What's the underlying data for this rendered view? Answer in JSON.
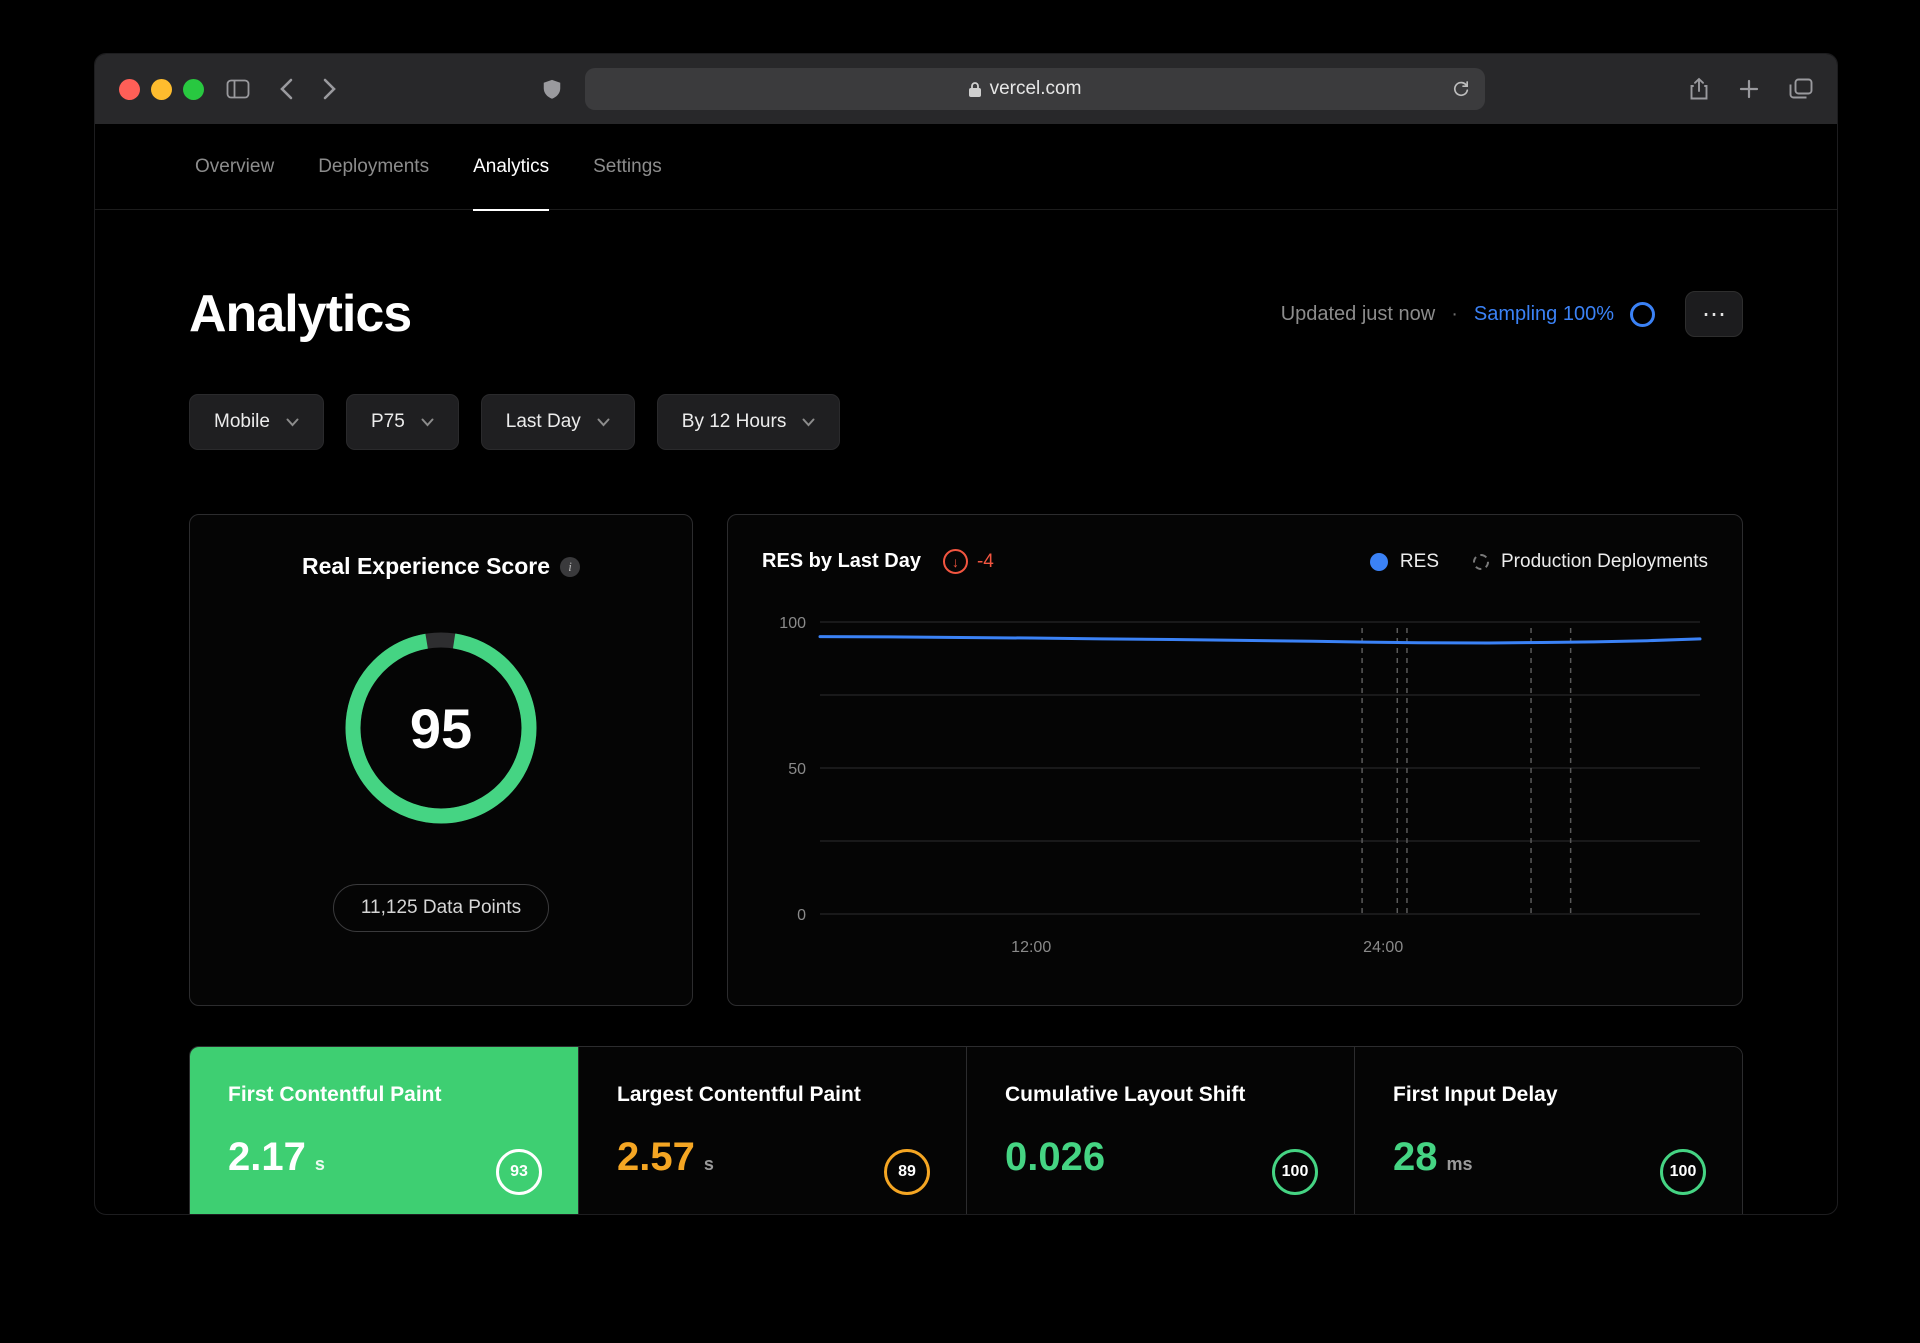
{
  "browser": {
    "url": "vercel.com",
    "traffic_lights": [
      "#ff5f57",
      "#febc2e",
      "#28c840"
    ]
  },
  "nav": {
    "tabs": [
      {
        "label": "Overview",
        "active": false
      },
      {
        "label": "Deployments",
        "active": false
      },
      {
        "label": "Analytics",
        "active": true
      },
      {
        "label": "Settings",
        "active": false
      }
    ]
  },
  "header": {
    "title": "Analytics",
    "updated": "Updated just now",
    "separator": "·",
    "sampling": "Sampling 100%",
    "accent_blue": "#3b82f6"
  },
  "icons": {
    "info": "i",
    "arrow_down": "↓",
    "ellipsis": "⋯"
  },
  "filters": [
    {
      "label": "Mobile"
    },
    {
      "label": "P75"
    },
    {
      "label": "Last Day"
    },
    {
      "label": "By 12 Hours"
    }
  ],
  "res_card": {
    "title": "Real Experience Score",
    "score": 95,
    "data_points": "11,125 Data Points",
    "ring_color": "#45d483"
  },
  "chart_card": {
    "title": "RES by Last Day",
    "delta": "-4",
    "delta_color": "#f25540",
    "legend": [
      {
        "label": "RES",
        "color": "#3b82f6"
      },
      {
        "label": "Production Deployments"
      }
    ]
  },
  "chart_data": {
    "type": "line",
    "title": "RES by Last Day",
    "ylim": [
      0,
      100
    ],
    "y_gridlines": [
      0,
      25,
      50,
      75,
      100
    ],
    "y_tick_labels": [
      100,
      50,
      0
    ],
    "x_ticks": [
      {
        "label": "12:00",
        "pos": 0.24
      },
      {
        "label": "24:00",
        "pos": 0.64
      }
    ],
    "series": [
      {
        "name": "RES",
        "color": "#3b82f6",
        "points": [
          [
            0,
            95
          ],
          [
            0.08,
            94.9
          ],
          [
            0.16,
            94.7
          ],
          [
            0.24,
            94.5
          ],
          [
            0.32,
            94.2
          ],
          [
            0.4,
            94.0
          ],
          [
            0.48,
            93.7
          ],
          [
            0.56,
            93.4
          ],
          [
            0.62,
            93.1
          ],
          [
            0.68,
            92.9
          ],
          [
            0.76,
            92.8
          ],
          [
            0.82,
            93.0
          ],
          [
            0.88,
            93.2
          ],
          [
            0.94,
            93.6
          ],
          [
            1,
            94.2
          ]
        ]
      }
    ],
    "deployments": {
      "name": "Production Deployments",
      "color": "#5a5a5a",
      "positions": [
        0.616,
        0.656,
        0.667,
        0.808,
        0.853
      ]
    }
  },
  "metrics": [
    {
      "title": "First Contentful Paint",
      "value": "2.17",
      "unit": "s",
      "score": "93",
      "bg": "#3ecf72",
      "ring_color": "#ffffff"
    },
    {
      "title": "Largest Contentful Paint",
      "value": "2.57",
      "unit": "s",
      "score": "89",
      "value_color": "#f5a623",
      "ring_color": "#f5a623"
    },
    {
      "title": "Cumulative Layout Shift",
      "value": "0.026",
      "unit": "",
      "score": "100",
      "value_color": "#45d483",
      "ring_color": "#45d483"
    },
    {
      "title": "First Input Delay",
      "value": "28",
      "unit": "ms",
      "score": "100",
      "value_color": "#45d483",
      "ring_color": "#45d483"
    }
  ]
}
